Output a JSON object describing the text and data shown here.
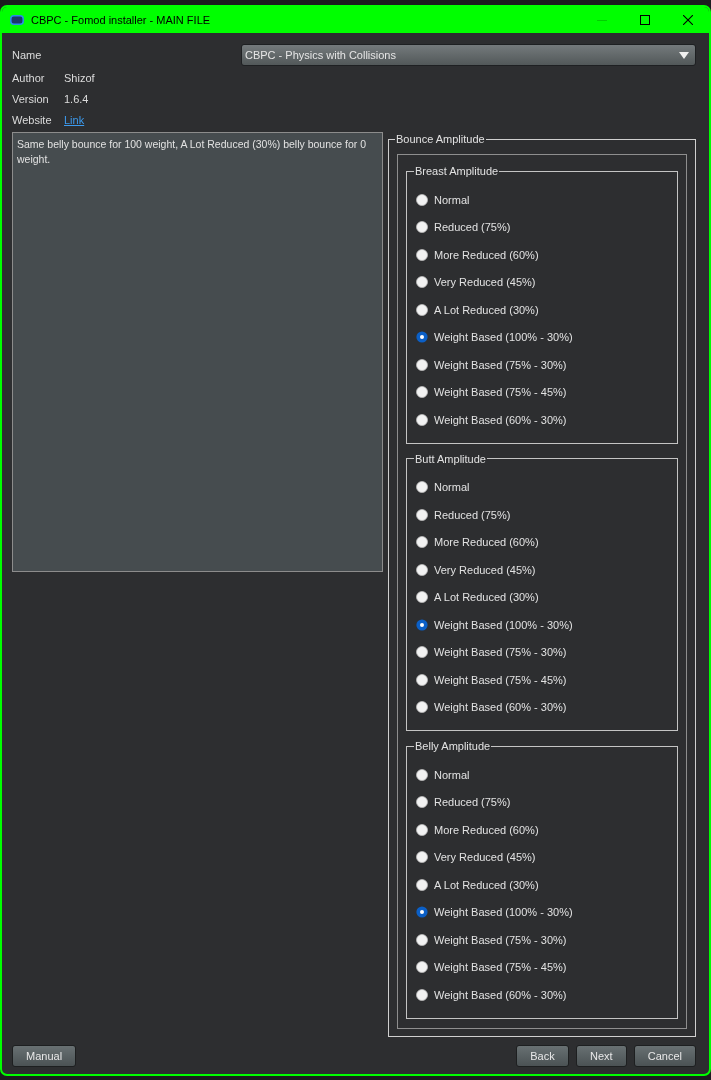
{
  "window": {
    "title": "CBPC - Fomod installer - MAIN FILE",
    "minimize_disabled": true
  },
  "fields": [
    {
      "kind": "dropdown",
      "label": "Name",
      "value": "CBPC - Physics with Collisions"
    },
    {
      "kind": "text",
      "label": "Author",
      "value": "Shizof"
    },
    {
      "kind": "text",
      "label": "Version",
      "value": "1.6.4"
    },
    {
      "kind": "link",
      "label": "Website",
      "value": "Link"
    }
  ],
  "description": "Same belly bounce for 100 weight, A Lot Reduced (30%) belly bounce for 0 weight.",
  "group": {
    "title": "Bounce Amplitude",
    "subgroups": [
      {
        "title": "Breast Amplitude",
        "options": [
          {
            "label": "Normal",
            "selected": false
          },
          {
            "label": "Reduced (75%)",
            "selected": false
          },
          {
            "label": "More Reduced (60%)",
            "selected": false
          },
          {
            "label": "Very Reduced (45%)",
            "selected": false
          },
          {
            "label": "A Lot Reduced (30%)",
            "selected": false
          },
          {
            "label": "Weight Based (100% - 30%)",
            "selected": true
          },
          {
            "label": "Weight Based (75% - 30%)",
            "selected": false
          },
          {
            "label": "Weight Based (75% - 45%)",
            "selected": false
          },
          {
            "label": "Weight Based (60% - 30%)",
            "selected": false
          }
        ]
      },
      {
        "title": "Butt Amplitude",
        "options": [
          {
            "label": "Normal",
            "selected": false
          },
          {
            "label": "Reduced (75%)",
            "selected": false
          },
          {
            "label": "More Reduced (60%)",
            "selected": false
          },
          {
            "label": "Very Reduced (45%)",
            "selected": false
          },
          {
            "label": "A Lot Reduced (30%)",
            "selected": false
          },
          {
            "label": "Weight Based (100% - 30%)",
            "selected": true
          },
          {
            "label": "Weight Based (75% - 30%)",
            "selected": false
          },
          {
            "label": "Weight Based (75% - 45%)",
            "selected": false
          },
          {
            "label": "Weight Based (60% - 30%)",
            "selected": false
          }
        ]
      },
      {
        "title": "Belly Amplitude",
        "options": [
          {
            "label": "Normal",
            "selected": false
          },
          {
            "label": "Reduced (75%)",
            "selected": false
          },
          {
            "label": "More Reduced (60%)",
            "selected": false
          },
          {
            "label": "Very Reduced (45%)",
            "selected": false
          },
          {
            "label": "A Lot Reduced (30%)",
            "selected": false
          },
          {
            "label": "Weight Based (100% - 30%)",
            "selected": true
          },
          {
            "label": "Weight Based (75% - 30%)",
            "selected": false
          },
          {
            "label": "Weight Based (75% - 45%)",
            "selected": false
          },
          {
            "label": "Weight Based (60% - 30%)",
            "selected": false
          }
        ]
      }
    ]
  },
  "left_buttons": [
    "Manual"
  ],
  "right_buttons": [
    "Back",
    "Next",
    "Cancel"
  ]
}
